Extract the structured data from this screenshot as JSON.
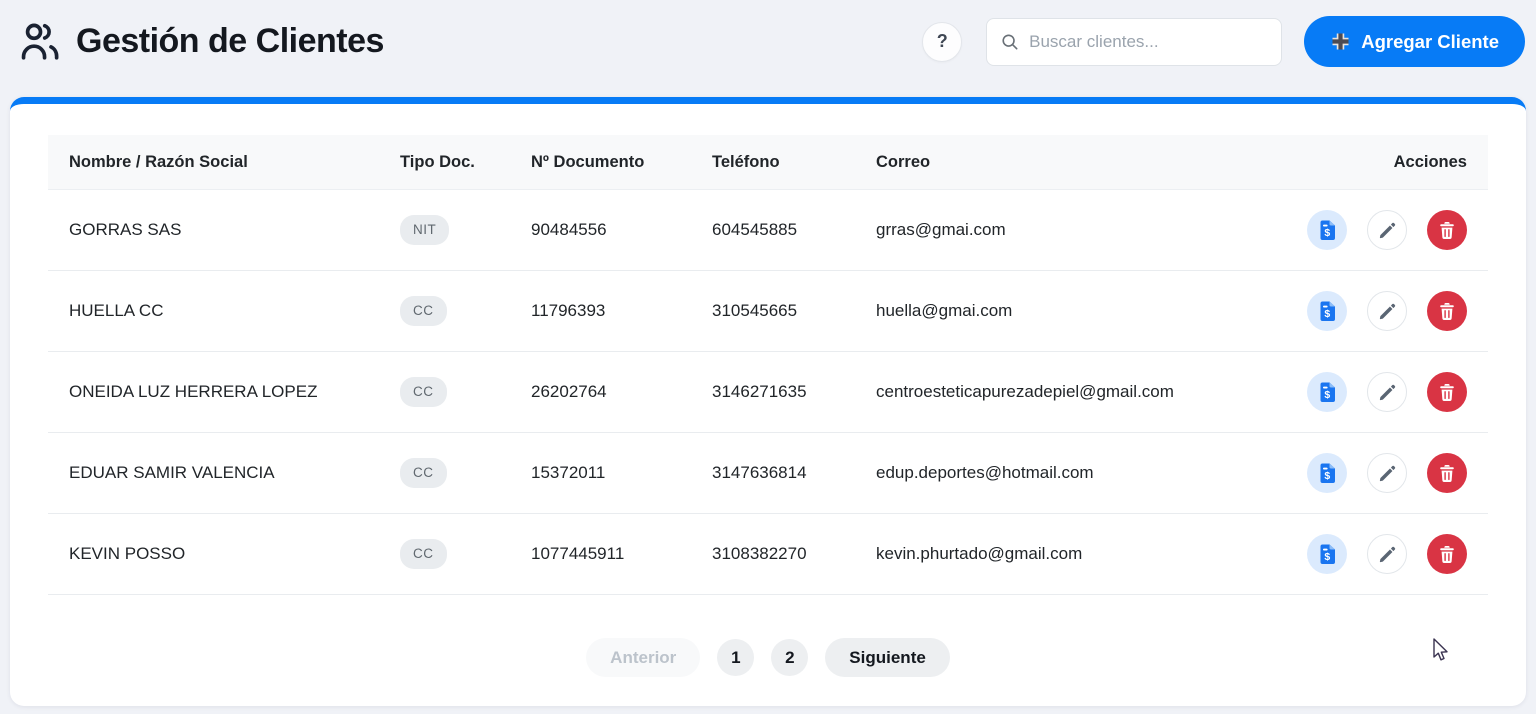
{
  "page": {
    "title": "Gestión de Clientes",
    "help_label": "?"
  },
  "search": {
    "placeholder": "Buscar clientes..."
  },
  "toolbar": {
    "add_client_label": "Agregar Cliente"
  },
  "table": {
    "columns": [
      "Nombre / Razón Social",
      "Tipo Doc.",
      "Nº Documento",
      "Teléfono",
      "Correo",
      "Acciones"
    ],
    "rows": [
      {
        "name": "GORRAS SAS",
        "doc_type": "NIT",
        "doc_number": "90484556",
        "phone": "604545885",
        "email": "grras@gmai.com"
      },
      {
        "name": "HUELLA CC",
        "doc_type": "CC",
        "doc_number": "11796393",
        "phone": "310545665",
        "email": "huella@gmai.com"
      },
      {
        "name": "ONEIDA LUZ HERRERA LOPEZ",
        "doc_type": "CC",
        "doc_number": "26202764",
        "phone": "3146271635",
        "email": "centroesteticapurezadepiel@gmail.com"
      },
      {
        "name": "EDUAR SAMIR VALENCIA",
        "doc_type": "CC",
        "doc_number": "15372011",
        "phone": "3147636814",
        "email": "edup.deportes@hotmail.com"
      },
      {
        "name": "KEVIN POSSO",
        "doc_type": "CC",
        "doc_number": "1077445911",
        "phone": "3108382270",
        "email": "kevin.phurtado@gmail.com"
      }
    ]
  },
  "pagination": {
    "previous_label": "Anterior",
    "pages": [
      "1",
      "2"
    ],
    "next_label": "Siguiente"
  },
  "icons": {
    "header": "people-icon",
    "help": "question-icon",
    "search": "magnifier-icon",
    "add": "plus-icon",
    "row_actions": [
      "file-invoice-dollar-icon",
      "pencil-icon",
      "trash-icon"
    ]
  },
  "colors": {
    "accent_blue": "#077bf6",
    "delete_red": "#d93444",
    "invoice_circle_bg": "#dbeafd",
    "badge_bg": "#e9ecef",
    "page_bg": "#f0f2f7",
    "header_row_bg": "#f8f9fa"
  }
}
